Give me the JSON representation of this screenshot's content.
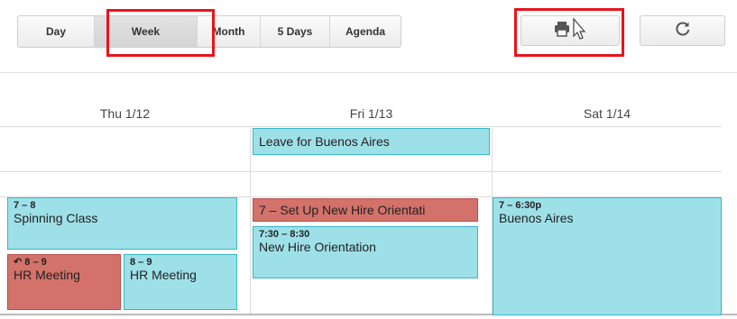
{
  "toolbar": {
    "views": [
      {
        "label": "Day"
      },
      {
        "label": "Week",
        "active": true
      },
      {
        "label": "Month"
      },
      {
        "label": "5 Days"
      },
      {
        "label": "Agenda"
      }
    ],
    "print_icon": "printer-icon",
    "refresh_icon": "refresh-icon",
    "highlight_color": "#e8141b"
  },
  "days": [
    {
      "label": "Thu 1/12"
    },
    {
      "label": "Fri 1/13"
    },
    {
      "label": "Sat 1/14"
    }
  ],
  "all_day_events": [
    {
      "title": "Leave for Buenos Aires"
    }
  ],
  "events": [
    {
      "time": "7 – 8",
      "title": "Spinning Class"
    },
    {
      "time": "",
      "title": "7 – Set Up New Hire Orientati"
    },
    {
      "time": "7:30 – 8:30",
      "title": "New Hire Orientation"
    },
    {
      "time": "7 – 6:30p",
      "title": "Buenos Aires"
    },
    {
      "time": "8 – 9",
      "title": "HR Meeting",
      "icon": "reply-icon"
    },
    {
      "time": "8 – 9",
      "title": "HR Meeting"
    }
  ],
  "colors": {
    "event": "#9ee0e8",
    "event_border": "#39b7c6",
    "event_alt": "#d2726a"
  }
}
